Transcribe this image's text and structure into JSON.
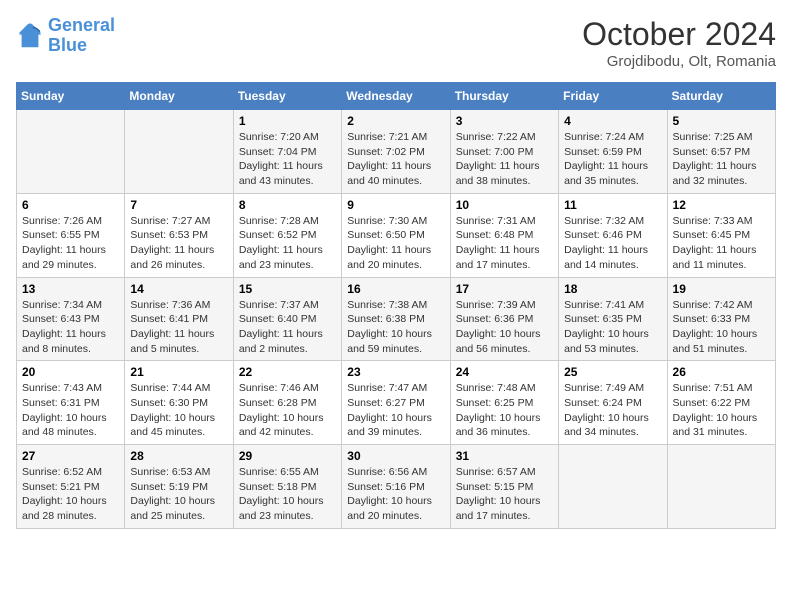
{
  "logo": {
    "line1": "General",
    "line2": "Blue"
  },
  "title": "October 2024",
  "location": "Grojdibodu, Olt, Romania",
  "days_header": [
    "Sunday",
    "Monday",
    "Tuesday",
    "Wednesday",
    "Thursday",
    "Friday",
    "Saturday"
  ],
  "weeks": [
    [
      {
        "day": "",
        "info": ""
      },
      {
        "day": "",
        "info": ""
      },
      {
        "day": "1",
        "info": "Sunrise: 7:20 AM\nSunset: 7:04 PM\nDaylight: 11 hours and 43 minutes."
      },
      {
        "day": "2",
        "info": "Sunrise: 7:21 AM\nSunset: 7:02 PM\nDaylight: 11 hours and 40 minutes."
      },
      {
        "day": "3",
        "info": "Sunrise: 7:22 AM\nSunset: 7:00 PM\nDaylight: 11 hours and 38 minutes."
      },
      {
        "day": "4",
        "info": "Sunrise: 7:24 AM\nSunset: 6:59 PM\nDaylight: 11 hours and 35 minutes."
      },
      {
        "day": "5",
        "info": "Sunrise: 7:25 AM\nSunset: 6:57 PM\nDaylight: 11 hours and 32 minutes."
      }
    ],
    [
      {
        "day": "6",
        "info": "Sunrise: 7:26 AM\nSunset: 6:55 PM\nDaylight: 11 hours and 29 minutes."
      },
      {
        "day": "7",
        "info": "Sunrise: 7:27 AM\nSunset: 6:53 PM\nDaylight: 11 hours and 26 minutes."
      },
      {
        "day": "8",
        "info": "Sunrise: 7:28 AM\nSunset: 6:52 PM\nDaylight: 11 hours and 23 minutes."
      },
      {
        "day": "9",
        "info": "Sunrise: 7:30 AM\nSunset: 6:50 PM\nDaylight: 11 hours and 20 minutes."
      },
      {
        "day": "10",
        "info": "Sunrise: 7:31 AM\nSunset: 6:48 PM\nDaylight: 11 hours and 17 minutes."
      },
      {
        "day": "11",
        "info": "Sunrise: 7:32 AM\nSunset: 6:46 PM\nDaylight: 11 hours and 14 minutes."
      },
      {
        "day": "12",
        "info": "Sunrise: 7:33 AM\nSunset: 6:45 PM\nDaylight: 11 hours and 11 minutes."
      }
    ],
    [
      {
        "day": "13",
        "info": "Sunrise: 7:34 AM\nSunset: 6:43 PM\nDaylight: 11 hours and 8 minutes."
      },
      {
        "day": "14",
        "info": "Sunrise: 7:36 AM\nSunset: 6:41 PM\nDaylight: 11 hours and 5 minutes."
      },
      {
        "day": "15",
        "info": "Sunrise: 7:37 AM\nSunset: 6:40 PM\nDaylight: 11 hours and 2 minutes."
      },
      {
        "day": "16",
        "info": "Sunrise: 7:38 AM\nSunset: 6:38 PM\nDaylight: 10 hours and 59 minutes."
      },
      {
        "day": "17",
        "info": "Sunrise: 7:39 AM\nSunset: 6:36 PM\nDaylight: 10 hours and 56 minutes."
      },
      {
        "day": "18",
        "info": "Sunrise: 7:41 AM\nSunset: 6:35 PM\nDaylight: 10 hours and 53 minutes."
      },
      {
        "day": "19",
        "info": "Sunrise: 7:42 AM\nSunset: 6:33 PM\nDaylight: 10 hours and 51 minutes."
      }
    ],
    [
      {
        "day": "20",
        "info": "Sunrise: 7:43 AM\nSunset: 6:31 PM\nDaylight: 10 hours and 48 minutes."
      },
      {
        "day": "21",
        "info": "Sunrise: 7:44 AM\nSunset: 6:30 PM\nDaylight: 10 hours and 45 minutes."
      },
      {
        "day": "22",
        "info": "Sunrise: 7:46 AM\nSunset: 6:28 PM\nDaylight: 10 hours and 42 minutes."
      },
      {
        "day": "23",
        "info": "Sunrise: 7:47 AM\nSunset: 6:27 PM\nDaylight: 10 hours and 39 minutes."
      },
      {
        "day": "24",
        "info": "Sunrise: 7:48 AM\nSunset: 6:25 PM\nDaylight: 10 hours and 36 minutes."
      },
      {
        "day": "25",
        "info": "Sunrise: 7:49 AM\nSunset: 6:24 PM\nDaylight: 10 hours and 34 minutes."
      },
      {
        "day": "26",
        "info": "Sunrise: 7:51 AM\nSunset: 6:22 PM\nDaylight: 10 hours and 31 minutes."
      }
    ],
    [
      {
        "day": "27",
        "info": "Sunrise: 6:52 AM\nSunset: 5:21 PM\nDaylight: 10 hours and 28 minutes."
      },
      {
        "day": "28",
        "info": "Sunrise: 6:53 AM\nSunset: 5:19 PM\nDaylight: 10 hours and 25 minutes."
      },
      {
        "day": "29",
        "info": "Sunrise: 6:55 AM\nSunset: 5:18 PM\nDaylight: 10 hours and 23 minutes."
      },
      {
        "day": "30",
        "info": "Sunrise: 6:56 AM\nSunset: 5:16 PM\nDaylight: 10 hours and 20 minutes."
      },
      {
        "day": "31",
        "info": "Sunrise: 6:57 AM\nSunset: 5:15 PM\nDaylight: 10 hours and 17 minutes."
      },
      {
        "day": "",
        "info": ""
      },
      {
        "day": "",
        "info": ""
      }
    ]
  ]
}
